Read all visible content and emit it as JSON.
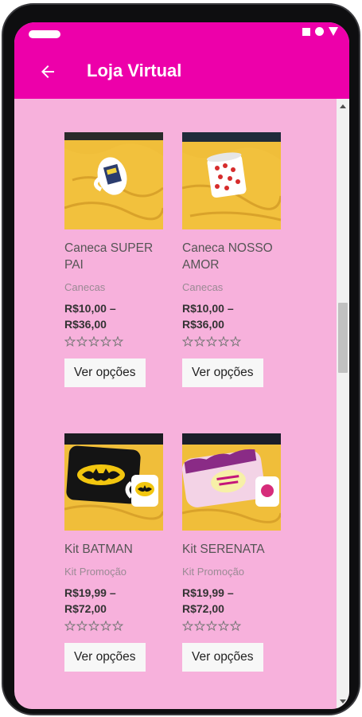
{
  "app": {
    "title": "Loja Virtual",
    "accent_color": "#ed00aa",
    "background_color": "#f7b1dc"
  },
  "status_bar": {
    "icons": [
      "square-icon",
      "circle-icon",
      "triangle-signal-icon"
    ]
  },
  "products": [
    {
      "name": "Caneca SUPER PAI",
      "category": "Canecas",
      "price_min": "R$10,00 –",
      "price_max": "R$36,00",
      "rating": 0,
      "button_label": "Ver opções"
    },
    {
      "name": "Caneca NOSSO AMOR",
      "category": "Canecas",
      "price_min": "R$10,00 –",
      "price_max": "R$36,00",
      "rating": 0,
      "button_label": "Ver opções"
    },
    {
      "name": "Kit BATMAN",
      "category": "Kit Promoção",
      "price_min": "R$19,99 –",
      "price_max": "R$72,00",
      "rating": 0,
      "button_label": "Ver opções"
    },
    {
      "name": "Kit SERENATA",
      "category": "Kit Promoção",
      "price_min": "R$19,99 –",
      "price_max": "R$72,00",
      "rating": 0,
      "button_label": "Ver opções"
    }
  ]
}
